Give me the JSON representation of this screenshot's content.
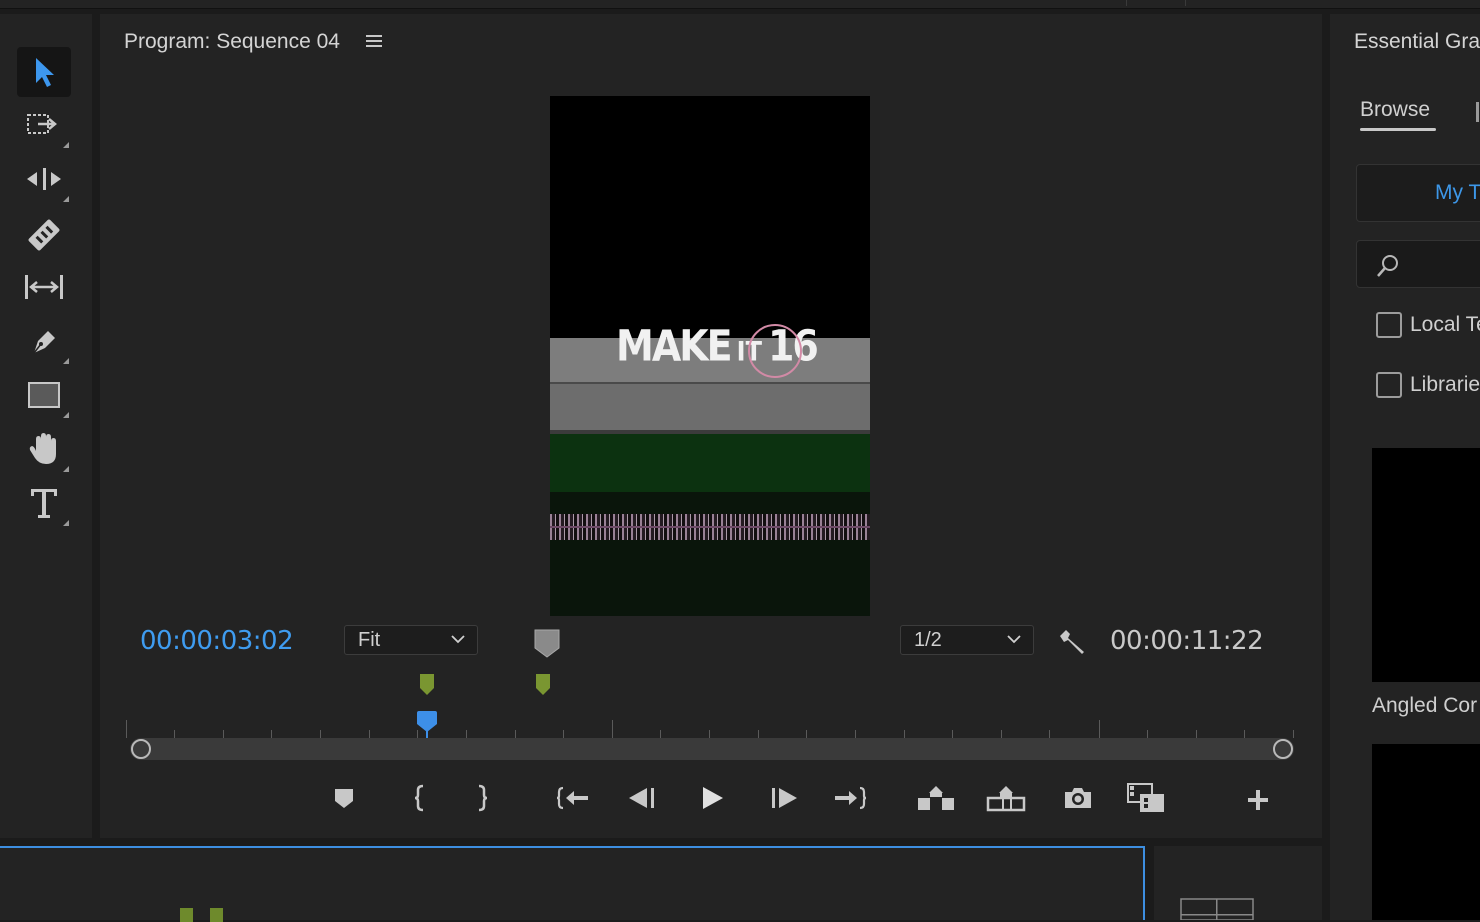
{
  "program_monitor": {
    "title": "Program: Sequence 04",
    "video_overlay_text_1": "MAKE",
    "video_overlay_text_2": "IT",
    "video_overlay_text_3": "16",
    "current_timecode": "00:00:03:02",
    "zoom_level": "Fit",
    "resolution": "1/2",
    "duration_timecode": "00:00:11:22",
    "playhead_position": 0.25
  },
  "tools": [
    "selection-tool",
    "track-select-forward-tool",
    "ripple-edit-tool",
    "razor-tool",
    "slip-tool",
    "pen-tool",
    "rectangle-tool",
    "hand-tool",
    "type-tool"
  ],
  "transport_controls": [
    "add-marker",
    "mark-in",
    "mark-out",
    "go-to-in",
    "step-back",
    "play",
    "step-forward",
    "go-to-out",
    "lift",
    "extract",
    "export-frame",
    "comparison-view",
    "button-editor"
  ],
  "essential_graphics": {
    "title": "Essential Gra",
    "browse_tab": "Browse",
    "my_templates_label": "My T",
    "local_checkbox": "Local Te",
    "libraries_checkbox": "Librarie",
    "template_label": "Angled Cor"
  },
  "colors": {
    "accent_blue": "#3f9cf0",
    "marker_green": "#7a9631",
    "panel_bg": "#232323"
  }
}
